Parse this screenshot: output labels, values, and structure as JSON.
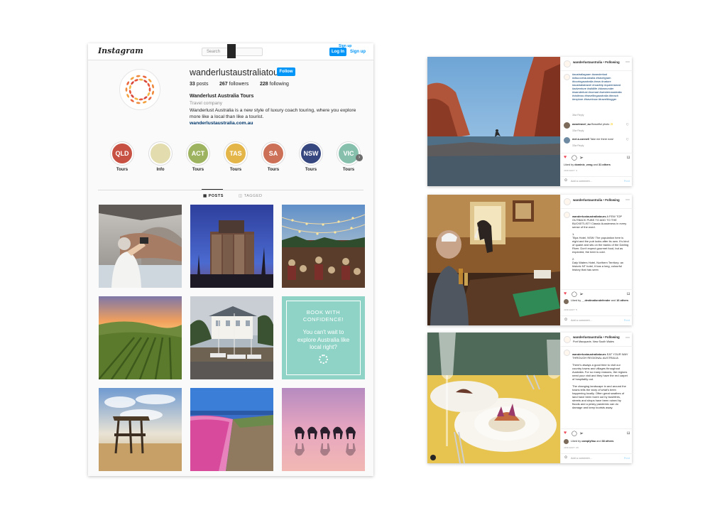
{
  "profile": {
    "logo_text": "Instagram",
    "search_placeholder": "Search",
    "login_label": "Log In",
    "signup_label": "Sign up",
    "signup_float": "Sign up",
    "username": "wanderlustaustraliatours",
    "follow_label": "Follow",
    "posts_count": "33",
    "posts_word": "posts",
    "followers_count": "267",
    "followers_word": "followers",
    "following_count": "228",
    "following_word": "following",
    "full_name": "Wanderlust Australia Tours",
    "category": "Travel company",
    "bio": "Wanderlust Australia is a new style of luxury coach touring, where you explore more like a local than like a tourist.",
    "website": "wanderlustaustralia.com.au",
    "highlights": [
      {
        "text": "QLD",
        "label": "Tours",
        "color": "#c75243"
      },
      {
        "text": "",
        "label": "Info",
        "color": "#e2dcae"
      },
      {
        "text": "ACT",
        "label": "Tours",
        "color": "#9db35f"
      },
      {
        "text": "TAS",
        "label": "Tours",
        "color": "#e4b548"
      },
      {
        "text": "SA",
        "label": "Tours",
        "color": "#cd7058"
      },
      {
        "text": "NSW",
        "label": "Tours",
        "color": "#36467e"
      },
      {
        "text": "VIC",
        "label": "Tours",
        "color": "#86bfac"
      }
    ],
    "next_arrow": "›",
    "tab_posts": "POSTS",
    "tab_tagged": "TAGGED",
    "promo_tile": {
      "line1": "BOOK WITH",
      "line2": "CONFIDENCE!",
      "body": "You can't wait to explore Australia like local right?"
    }
  },
  "posts": [
    {
      "username": "wanderlustaustralia",
      "following": "• Following",
      "location": "",
      "caption_user": "",
      "caption": "#australiagram #wanderlust #discoveraustralia #travelgram #touringaustralia #nsw #nature #australiatravel #roadtrip #queensland #adventure #wildlife #downunder #wanderlust #nomad #westernaustralia #visitnsw #travellingaustralia #beach #explore #travelnow #travelblogger",
      "caption_meta": "36w   Reply",
      "comments": [
        {
          "user": "aswetravel_au",
          "text": "Beautiful photo ✨",
          "meta": "33w   Reply"
        },
        {
          "user": "mel.a.connell",
          "text": "Take me there now!",
          "meta": "33w   Reply"
        }
      ],
      "likes_prefix": "Liked by",
      "likes_user": "dominic_zeng",
      "likes_and": "and",
      "likes_others": "31 others",
      "date": "JANUARY 4",
      "add_comment": "Add a comment...",
      "post_btn": "Post"
    },
    {
      "username": "wanderlustaustralia",
      "following": "• Following",
      "location": "",
      "caption_user": "wanderlustaustraliatours",
      "caption": "A FEW TOP OUTBACK PUBS TO ADD TO THE BUCKETLIST! Classic Aussieness in every sense of the word.\n\n1.\nTilpa Hotel, NSW: The population here is eight and the pub looks after its own. It's kind of quaint and sits on the banks of the Darling River. Don't expect gourmet food, but as expected, the beer is cold.\n\n2.\nDaly Waters Hotel, Northern Territory: an historic NT hotel, it has a long, colourful history that has seen",
      "caption_meta": "",
      "comments": [],
      "likes_prefix": "Liked by",
      "likes_user": "__destinationdefender",
      "likes_and": "and",
      "likes_others": "16 others",
      "date": "JANUARY 5",
      "add_comment": "Add a comment...",
      "post_btn": "Post"
    },
    {
      "username": "wanderlustaustralia",
      "following": "• Following",
      "location": "Port Macquarie, New South Wales",
      "caption_user": "wanderlustaustraliatours",
      "caption": "EAT YOUR WAY THROUGH REGIONAL AUSTRALIA\n\nThere's always a good time to visit our country towns and villages throughout Australia. For so many reasons, the regions need your visit and they have the red carpet of hospitality out.\n\nThe changing landscape in and around the towns tells the story of what's been happening locally. Often great swathes of land have been burnt out by bushfires, streets and shops have been ruined by floods and a pesky pandemic can do damage and keep tourists away.",
      "caption_meta": "",
      "comments": [],
      "likes_prefix": "Liked by",
      "likes_user": "camplyflau",
      "likes_and": "and",
      "likes_others": "38 others",
      "date": "JANUARY 26",
      "add_comment": "Add a comment...",
      "post_btn": "Post"
    }
  ]
}
